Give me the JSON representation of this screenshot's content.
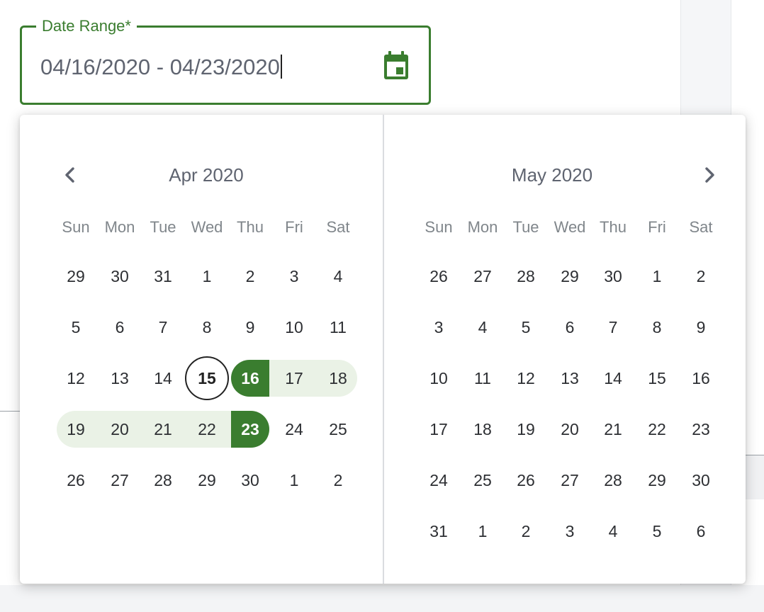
{
  "date_field": {
    "label": "Date Range*",
    "value": "04/16/2020 - 04/23/2020",
    "icon": "calendar-icon"
  },
  "colors": {
    "accent": "#3a7d2f",
    "range_fill": "#eaf2e6",
    "text": "#2d2f33",
    "muted": "#80868b"
  },
  "picker": {
    "prev_icon": "chevron-left-icon",
    "next_icon": "chevron-right-icon",
    "weekdays": [
      "Sun",
      "Mon",
      "Tue",
      "Wed",
      "Thu",
      "Fri",
      "Sat"
    ],
    "months": [
      {
        "title": "Apr 2020",
        "weeks": [
          [
            "29",
            "30",
            "31",
            "1",
            "2",
            "3",
            "4"
          ],
          [
            "5",
            "6",
            "7",
            "8",
            "9",
            "10",
            "11"
          ],
          [
            "12",
            "13",
            "14",
            "15",
            "16",
            "17",
            "18"
          ],
          [
            "19",
            "20",
            "21",
            "22",
            "23",
            "24",
            "25"
          ],
          [
            "26",
            "27",
            "28",
            "29",
            "30",
            "1",
            "2"
          ]
        ]
      },
      {
        "title": "May 2020",
        "weeks": [
          [
            "26",
            "27",
            "28",
            "29",
            "30",
            "1",
            "2"
          ],
          [
            "3",
            "4",
            "5",
            "6",
            "7",
            "8",
            "9"
          ],
          [
            "10",
            "11",
            "12",
            "13",
            "14",
            "15",
            "16"
          ],
          [
            "17",
            "18",
            "19",
            "20",
            "21",
            "22",
            "23"
          ],
          [
            "24",
            "25",
            "26",
            "27",
            "28",
            "29",
            "30"
          ],
          [
            "31",
            "1",
            "2",
            "3",
            "4",
            "5",
            "6"
          ]
        ]
      }
    ],
    "today": "2020-04-15",
    "range_start": "2020-04-16",
    "range_end": "2020-04-23"
  }
}
